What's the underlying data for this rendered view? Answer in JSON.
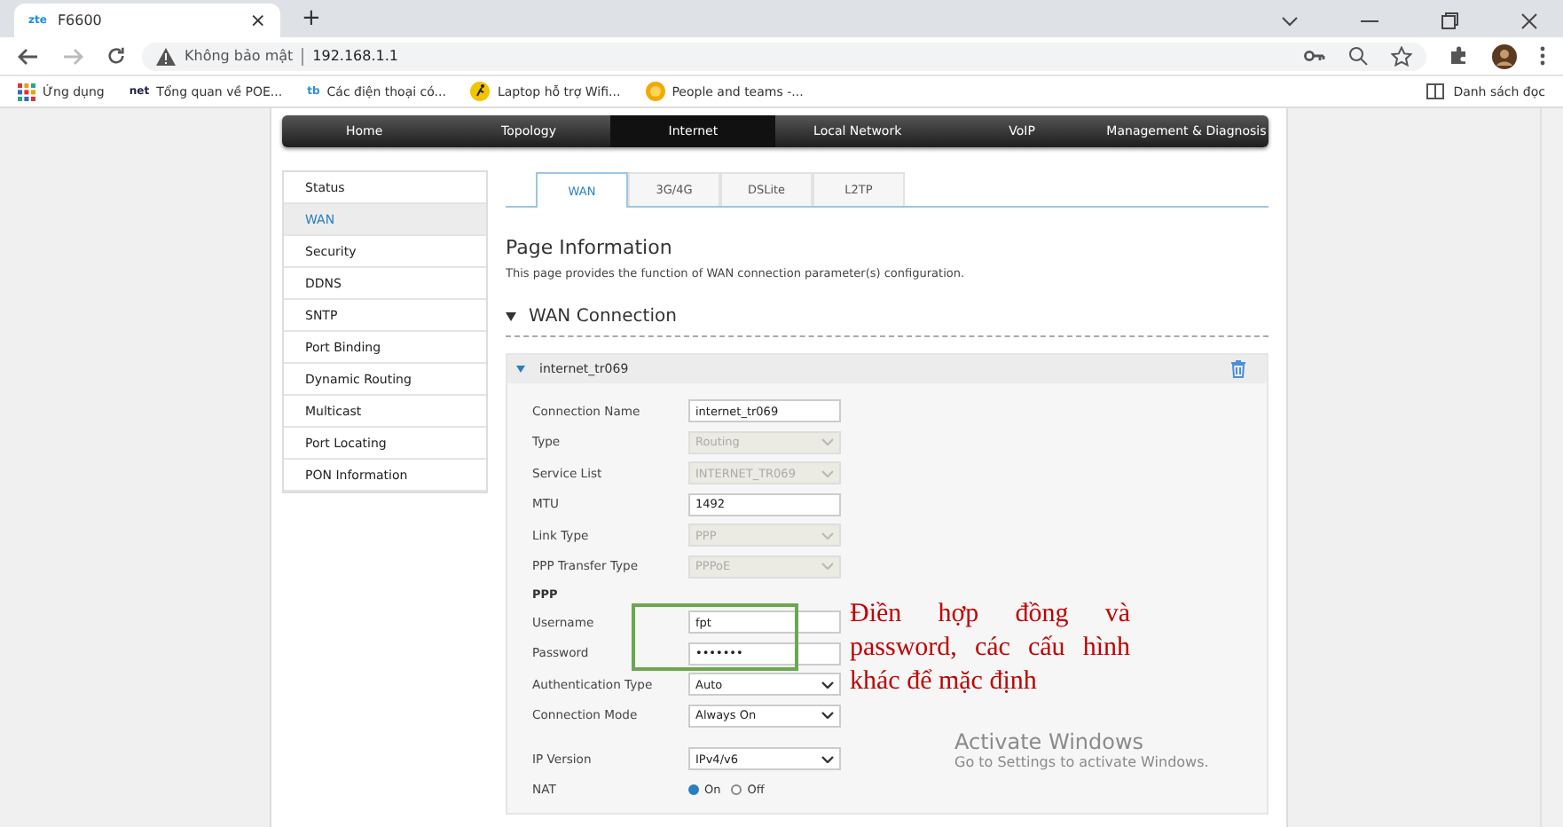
{
  "browser": {
    "tab": {
      "icon_text": "zte",
      "title": "F6600",
      "close": "×"
    },
    "new_tab": "+",
    "address": {
      "security": "Không bảo mật",
      "url": "192.168.1.1"
    },
    "bookmarks": [
      {
        "kind": "apps",
        "label": "Ứng dụng"
      },
      {
        "kind": "net",
        "icon_text": "net",
        "label": "Tổng quan về POE..."
      },
      {
        "kind": "phone",
        "icon_text": "tb",
        "label": "Các điện thoại có..."
      },
      {
        "kind": "runner",
        "label": "Laptop hỗ trợ Wifi..."
      },
      {
        "kind": "people",
        "label": "People and teams -..."
      }
    ],
    "reading_list": "Danh sách đọc"
  },
  "nav": [
    {
      "label": "Home",
      "selected": false
    },
    {
      "label": "Topology",
      "selected": false
    },
    {
      "label": "Internet",
      "selected": true
    },
    {
      "label": "Local Network",
      "selected": false
    },
    {
      "label": "VoIP",
      "selected": false
    },
    {
      "label": "Management & Diagnosis",
      "selected": false
    }
  ],
  "sidebar": [
    {
      "label": "Status",
      "selected": false
    },
    {
      "label": "WAN",
      "selected": true
    },
    {
      "label": "Security",
      "selected": false
    },
    {
      "label": "DDNS",
      "selected": false
    },
    {
      "label": "SNTP",
      "selected": false
    },
    {
      "label": "Port Binding",
      "selected": false
    },
    {
      "label": "Dynamic Routing",
      "selected": false
    },
    {
      "label": "Multicast",
      "selected": false
    },
    {
      "label": "Port Locating",
      "selected": false
    },
    {
      "label": "PON Information",
      "selected": false
    }
  ],
  "tabs": [
    {
      "label": "WAN",
      "selected": true
    },
    {
      "label": "3G/4G",
      "selected": false
    },
    {
      "label": "DSLite",
      "selected": false
    },
    {
      "label": "L2TP",
      "selected": false
    }
  ],
  "page_info": {
    "title": "Page Information",
    "description": "This page provides the function of WAN connection parameter(s) configuration."
  },
  "section": {
    "title": "WAN Connection",
    "connection": "internet_tr069"
  },
  "fields": [
    {
      "kind": "text",
      "label": "Connection Name",
      "value": "internet_tr069"
    },
    {
      "kind": "select",
      "label": "Type",
      "value": "Routing",
      "disabled": true
    },
    {
      "kind": "select",
      "label": "Service List",
      "value": "INTERNET_TR069",
      "disabled": true
    },
    {
      "kind": "text",
      "label": "MTU",
      "value": "1492"
    },
    {
      "kind": "select",
      "label": "Link Type",
      "value": "PPP",
      "disabled": true
    },
    {
      "kind": "select",
      "label": "PPP Transfer Type",
      "value": "PPPoE",
      "disabled": true
    },
    {
      "kind": "heading",
      "label": "PPP"
    },
    {
      "kind": "text",
      "label": "Username",
      "value": "fpt"
    },
    {
      "kind": "text",
      "label": "Password",
      "value": "•••••••"
    },
    {
      "kind": "select",
      "label": "Authentication Type",
      "value": "Auto",
      "disabled": false
    },
    {
      "kind": "select",
      "label": "Connection Mode",
      "value": "Always On",
      "disabled": false
    },
    {
      "kind": "spacer"
    },
    {
      "kind": "select",
      "label": "IP Version",
      "value": "IPv4/v6",
      "disabled": false
    },
    {
      "kind": "radio",
      "label": "NAT",
      "options": [
        {
          "label": "On",
          "selected": true
        },
        {
          "label": "Off",
          "selected": false
        }
      ]
    }
  ],
  "annotation": "Điền hợp đồng và password, các cấu hình khác để mặc định",
  "os_notice": {
    "title": "Activate Windows",
    "text": "Go to Settings to activate Windows."
  }
}
